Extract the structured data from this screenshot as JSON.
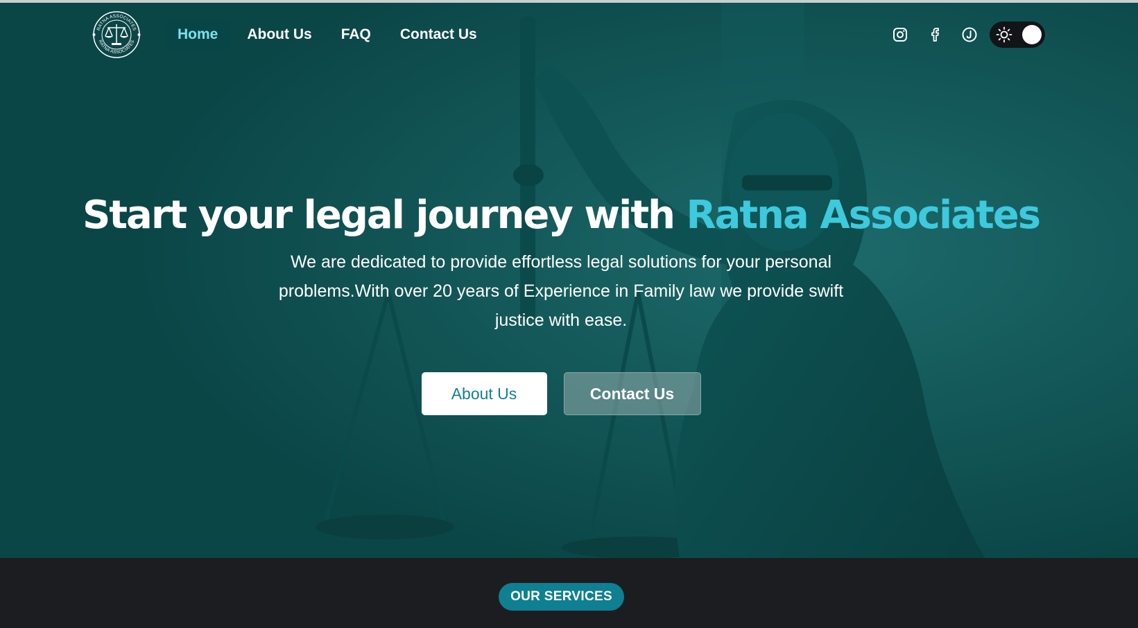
{
  "brand": {
    "logo_text": "RATNA ASSOCIATES",
    "logo_icon": "scales-of-justice-icon"
  },
  "nav": {
    "items": [
      {
        "label": "Home",
        "active": true
      },
      {
        "label": "About Us",
        "active": false
      },
      {
        "label": "FAQ",
        "active": false
      },
      {
        "label": "Contact Us",
        "active": false
      }
    ]
  },
  "social": {
    "icons": [
      "instagram-icon",
      "facebook-icon",
      "justdial-icon"
    ]
  },
  "theme_toggle": {
    "icon": "sun-icon",
    "mode": "light"
  },
  "hero": {
    "headline_main": "Start your legal journey with ",
    "headline_accent": "Ratna Associates",
    "subtext": "We are dedicated to provide effortless legal solutions for your personal problems.With over 20 years of Experience in Family law we provide swift justice with ease.",
    "buttons": {
      "about": "About Us",
      "contact": "Contact Us"
    }
  },
  "services": {
    "badge": "OUR SERVICES"
  },
  "colors": {
    "hero_bg": "#0d4f50",
    "accent": "#3ec9dd",
    "badge": "#0f7f92",
    "dark": "#1c1d21"
  }
}
